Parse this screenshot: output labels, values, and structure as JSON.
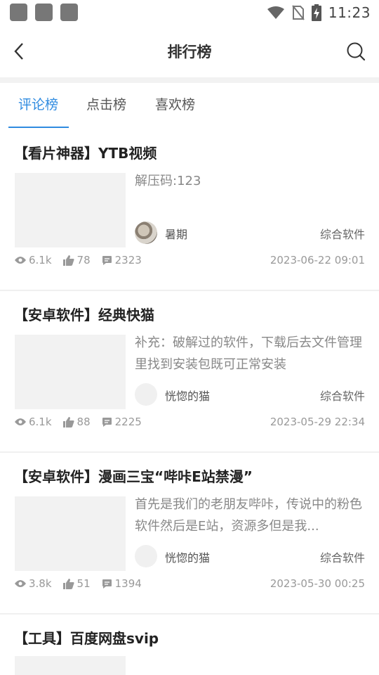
{
  "status_bar": {
    "time": "11:23"
  },
  "header": {
    "title": "排行榜"
  },
  "tabs": [
    {
      "label": "评论榜",
      "active": true
    },
    {
      "label": "点击榜",
      "active": false
    },
    {
      "label": "喜欢榜",
      "active": false
    }
  ],
  "posts": [
    {
      "title": "【看片神器】YTB视频",
      "desc": "解压码:123",
      "author": "暑期",
      "category": "综合软件",
      "views": "6.1k",
      "likes": "78",
      "comments": "2323",
      "date": "2023-06-22 09:01"
    },
    {
      "title": "【安卓软件】经典快猫",
      "desc": "补充：破解过的软件，下载后去文件管理里找到安装包既可正常安装",
      "author": "恍惚的猫",
      "category": "综合软件",
      "views": "6.1k",
      "likes": "88",
      "comments": "2225",
      "date": "2023-05-29 22:34"
    },
    {
      "title": "【安卓软件】漫画三宝“哔咔E站禁漫”",
      "desc": "首先是我们的老朋友哔咔，传说中的粉色软件然后是E站，资源多但是我...",
      "author": "恍惚的猫",
      "category": "综合软件",
      "views": "3.8k",
      "likes": "51",
      "comments": "1394",
      "date": "2023-05-30 00:25"
    },
    {
      "title": "【工具】百度网盘svip"
    }
  ],
  "colors": {
    "accent": "#2f8be0",
    "muted": "#999999",
    "divider": "#f2f2f2"
  },
  "icons": [
    "back-arrow-icon",
    "search-icon",
    "eye-icon",
    "thumbs-up-icon",
    "comment-icon",
    "wifi-icon",
    "no-sim-icon",
    "battery-charging-icon"
  ]
}
